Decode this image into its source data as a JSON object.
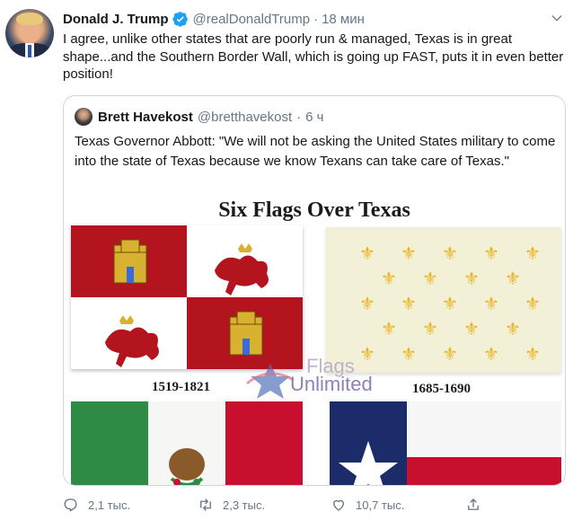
{
  "tweet": {
    "author_name": "Donald J. Trump",
    "handle": "@realDonaldTrump",
    "separator": "·",
    "time": "18 мин",
    "text": "I agree, unlike other states that are poorly run & managed, Texas is in great shape...and the Southern Border Wall, which is going up FAST, puts it in even better position!"
  },
  "quote": {
    "author_name": "Brett Havekost",
    "handle": "@bretthavekost",
    "separator": "·",
    "time": "6 ч",
    "text": "Texas Governor Abbott: \"We will not be asking the United States military to come into the state of Texas because we know Texans can take care of Texas.\"",
    "media": {
      "title": "Six Flags Over Texas",
      "flags": [
        {
          "caption": "1519-1821"
        },
        {
          "caption": "1685-1690"
        }
      ],
      "watermark": {
        "line1": "Flags",
        "line2": "Unlimited"
      }
    }
  },
  "actions": {
    "reply_count": "2,1 тыс.",
    "retweet_count": "2,3 тыс.",
    "like_count": "10,7 тыс."
  },
  "colors": {
    "text": "#14171a",
    "secondary": "#657786",
    "verified": "#1da1f2",
    "border": "#ccd6dd",
    "spain_red": "#b3141e",
    "gold": "#d8b131",
    "fleur": "#e8b51f",
    "mexico_green": "#2e8b46",
    "texas_blue": "#1c2c6b",
    "texas_red": "#c8102e"
  },
  "icons": [
    "verified-badge-icon",
    "caret-down-icon",
    "reply-icon",
    "retweet-icon",
    "like-icon",
    "share-icon"
  ]
}
